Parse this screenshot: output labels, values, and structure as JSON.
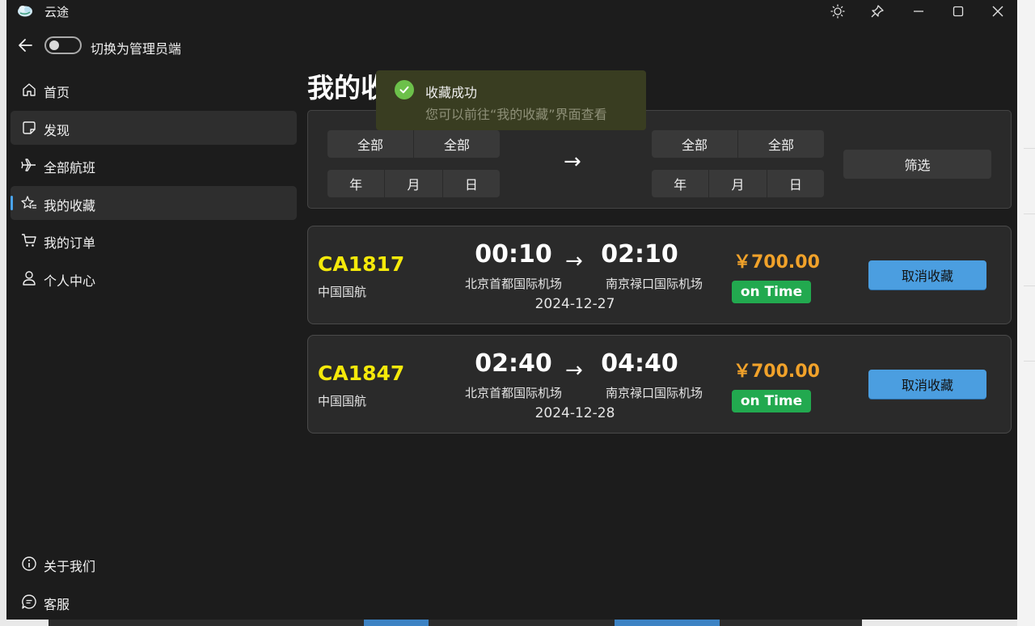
{
  "window": {
    "title": "云途"
  },
  "titlebar": {
    "theme_icon": "sun-icon",
    "pin_icon": "pin-icon",
    "minimize_icon": "minimize-icon",
    "maximize_icon": "maximize-icon",
    "close_icon": "close-icon"
  },
  "top": {
    "toggle_label": "切换为管理员端",
    "toggle_on": false
  },
  "sidebar": {
    "items": [
      {
        "label": "首页",
        "icon": "home-icon",
        "active": false
      },
      {
        "label": "发现",
        "icon": "note-icon",
        "active": false
      },
      {
        "label": "全部航班",
        "icon": "airplane-icon",
        "active": false
      },
      {
        "label": "我的收藏",
        "icon": "star-list-icon",
        "active": true
      },
      {
        "label": "我的订单",
        "icon": "cart-icon",
        "active": false
      },
      {
        "label": "个人中心",
        "icon": "person-icon",
        "active": false
      }
    ],
    "footer": [
      {
        "label": "关于我们",
        "icon": "info-icon"
      },
      {
        "label": "客服",
        "icon": "chat-icon"
      }
    ]
  },
  "page": {
    "title": "我的收"
  },
  "filter": {
    "from_place": [
      "全部",
      "全部"
    ],
    "from_date": [
      "年",
      "月",
      "日"
    ],
    "arrow": "→",
    "to_place": [
      "全部",
      "全部"
    ],
    "to_date": [
      "年",
      "月",
      "日"
    ],
    "filter_label": "筛选"
  },
  "flights": [
    {
      "flight_no": "CA1817",
      "airline": "中国国航",
      "dep_time": "00:10",
      "dep_airport": "北京首都国际机场",
      "arr_time": "02:10",
      "arr_airport": "南京禄口国际机场",
      "date": "2024-12-27",
      "price": "￥700.00",
      "status": "on Time",
      "action": "取消收藏"
    },
    {
      "flight_no": "CA1847",
      "airline": "中国国航",
      "dep_time": "02:40",
      "dep_airport": "北京首都国际机场",
      "arr_time": "04:40",
      "arr_airport": "南京禄口国际机场",
      "date": "2024-12-28",
      "price": "￥700.00",
      "status": "on Time",
      "action": "取消收藏"
    }
  ],
  "toast": {
    "title": "收藏成功",
    "message": "您可以前往“我的收藏”界面查看",
    "icon": "check-circle-icon"
  },
  "colors": {
    "accent": "#4aa4ee",
    "flight_no": "#f5e90a",
    "price": "#f1a22a",
    "status_ok": "#22a94f",
    "cancel_button": "#4b9ee0"
  }
}
